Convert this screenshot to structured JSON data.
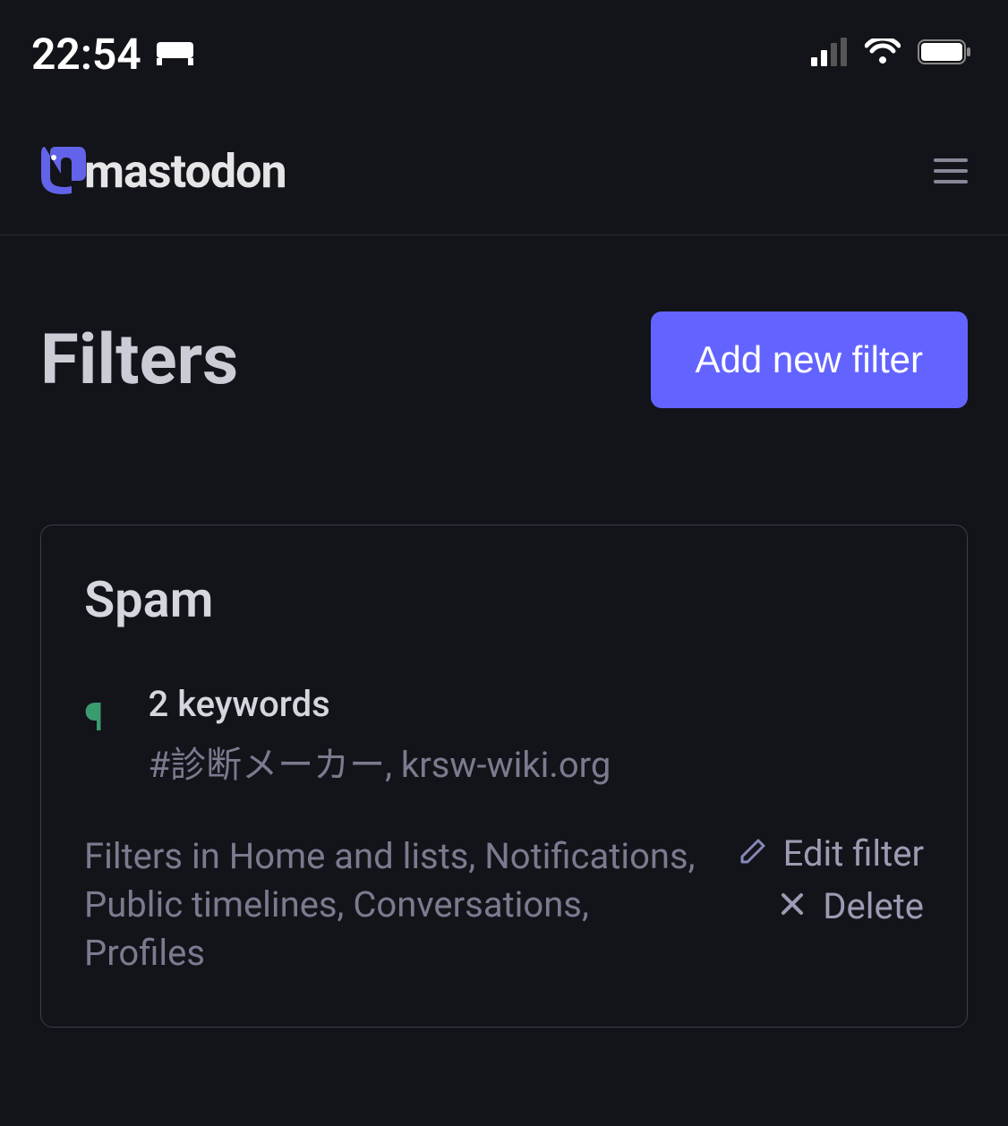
{
  "status": {
    "time": "22:54"
  },
  "header": {
    "brand": "mastodon"
  },
  "page": {
    "title": "Filters",
    "add_button_label": "Add new filter"
  },
  "filters": [
    {
      "name": "Spam",
      "keyword_count_label": "2 keywords",
      "keywords_display": "#診断メーカー, krsw-wiki.org",
      "contexts_display": "Filters in Home and lists, Notifications, Public timelines, Conversations, Profiles",
      "actions": {
        "edit_label": "Edit filter",
        "delete_label": "Delete"
      }
    }
  ]
}
